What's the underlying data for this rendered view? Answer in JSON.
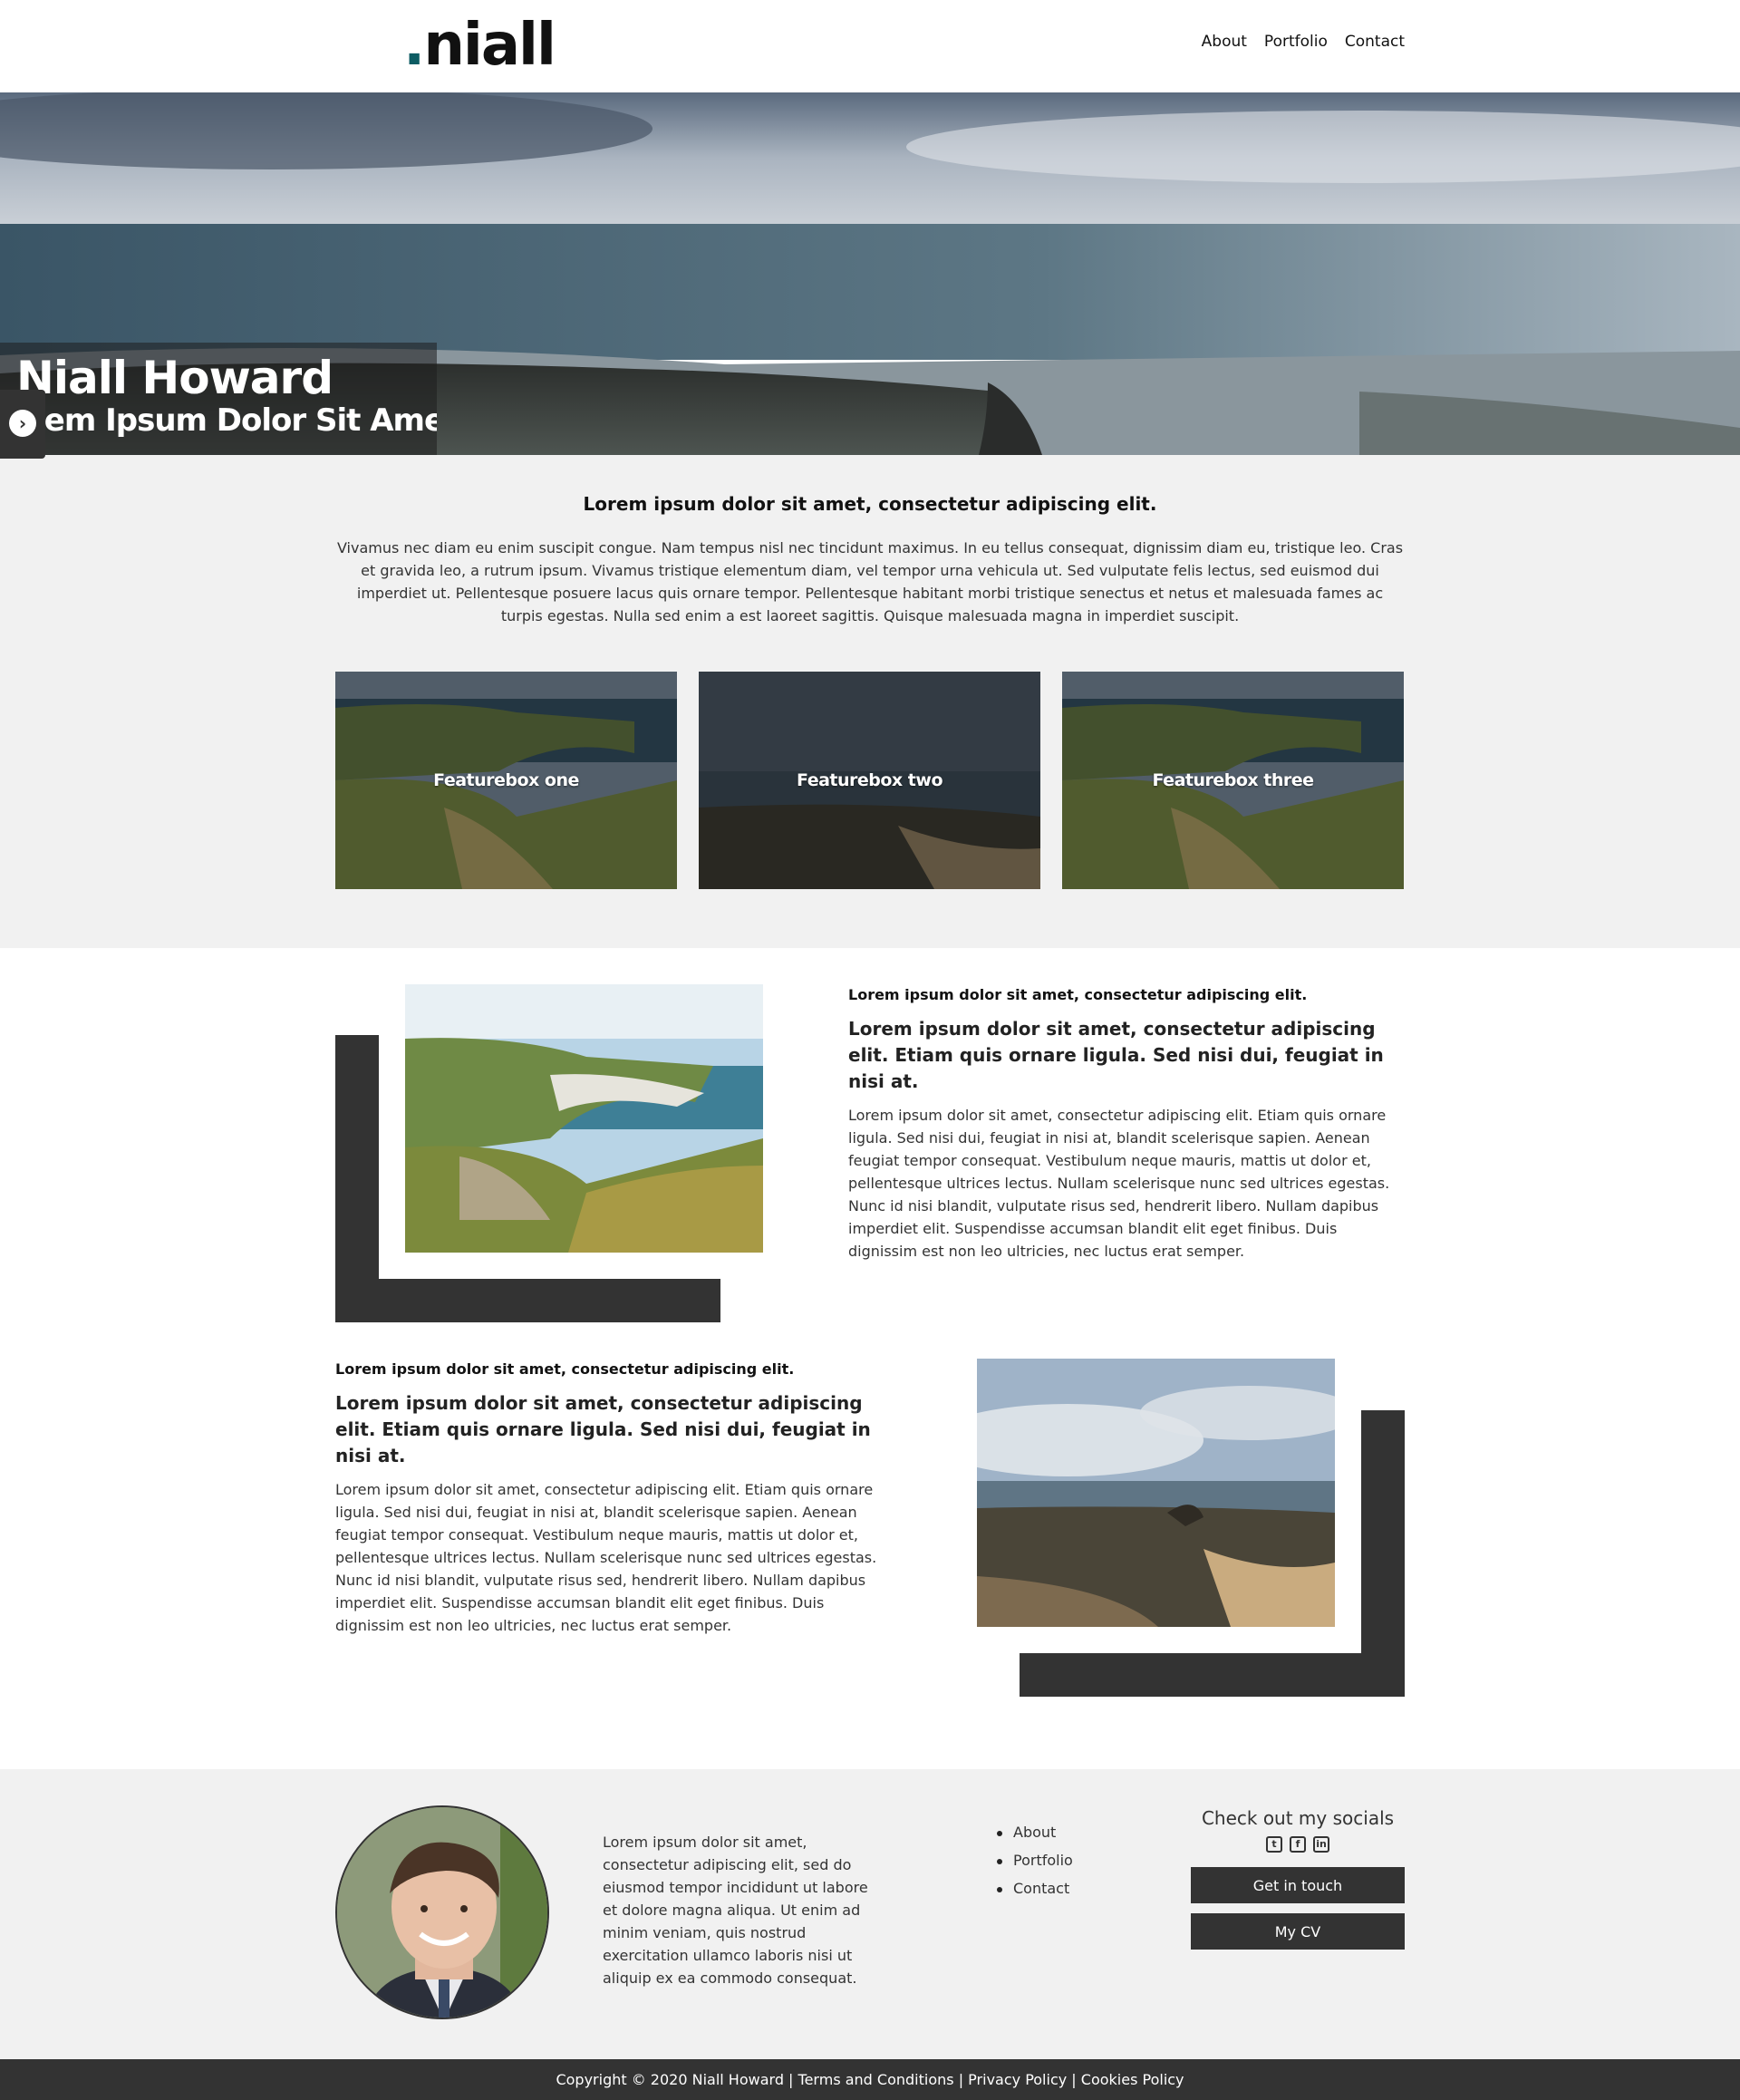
{
  "header": {
    "logo_dot": ".",
    "logo_text": "niall",
    "nav": [
      {
        "label": "About"
      },
      {
        "label": "Portfolio"
      },
      {
        "label": "Contact"
      }
    ]
  },
  "hero": {
    "name": "Niall Howard",
    "tagline": "Lorem Ipsum Dolor Sit Amet",
    "arrow_icon": "chevron-right-circle-icon"
  },
  "intro": {
    "title": "Lorem ipsum dolor sit amet, consectetur adipiscing elit.",
    "body": "Vivamus nec diam eu enim suscipit congue. Nam tempus nisl nec tincidunt maximus. In eu tellus consequat, dignissim diam eu, tristique leo. Cras et gravida leo, a rutrum ipsum. Vivamus tristique elementum diam, vel tempor urna vehicula ut. Sed vulputate felis lectus, sed euismod dui imperdiet ut. Pellentesque posuere lacus quis ornare tempor. Pellentesque habitant morbi tristique senectus et netus et malesuada fames ac turpis egestas. Nulla sed enim a est laoreet sagittis. Quisque malesuada magna in imperdiet suscipit.",
    "featureboxes": [
      {
        "label": "Featurebox one"
      },
      {
        "label": "Featurebox two"
      },
      {
        "label": "Featurebox three"
      }
    ]
  },
  "content": [
    {
      "kicker": "Lorem ipsum dolor sit amet, consectetur adipiscing elit.",
      "heading": "Lorem ipsum dolor sit amet, consectetur adipiscing elit. Etiam quis ornare ligula. Sed nisi dui, feugiat in nisi at.",
      "body": "Lorem ipsum dolor sit amet, consectetur adipiscing elit. Etiam quis ornare ligula. Sed nisi dui, feugiat in nisi at, blandit scelerisque sapien. Aenean feugiat tempor consequat. Vestibulum neque mauris, mattis ut dolor et, pellentesque ultrices lectus. Nullam scelerisque nunc sed ultrices egestas. Nunc id nisi blandit, vulputate risus sed, hendrerit libero. Nullam dapibus imperdiet elit. Suspendisse accumsan blandit elit eget finibus. Duis dignissim est non leo ultricies, nec luctus erat semper."
    },
    {
      "kicker": "Lorem ipsum dolor sit amet, consectetur adipiscing elit.",
      "heading": "Lorem ipsum dolor sit amet, consectetur adipiscing elit. Etiam quis ornare ligula. Sed nisi dui, feugiat in nisi at.",
      "body": "Lorem ipsum dolor sit amet, consectetur adipiscing elit. Etiam quis ornare ligula. Sed nisi dui, feugiat in nisi at, blandit scelerisque sapien. Aenean feugiat tempor consequat. Vestibulum neque mauris, mattis ut dolor et, pellentesque ultrices lectus. Nullam scelerisque nunc sed ultrices egestas. Nunc id nisi blandit, vulputate risus sed, hendrerit libero. Nullam dapibus imperdiet elit. Suspendisse accumsan blandit elit eget finibus. Duis dignissim est non leo ultricies, nec luctus erat semper."
    }
  ],
  "footer": {
    "about": "Lorem ipsum dolor sit amet, consectetur adipiscing elit, sed do eiusmod tempor incididunt ut labore et dolore magna aliqua. Ut enim ad minim veniam, quis nostrud exercitation ullamco laboris nisi ut aliquip ex ea commodo consequat.",
    "links": [
      {
        "label": "About"
      },
      {
        "label": "Portfolio"
      },
      {
        "label": "Contact"
      }
    ],
    "socials_title": "Check out my socials",
    "social_icons": [
      "twitter-icon",
      "facebook-icon",
      "linkedin-icon"
    ],
    "get_in_touch": "Get in touch",
    "my_cv": "My CV"
  },
  "copyright": "Copyright © 2020 Niall Howard | Terms and Conditions | Privacy Policy | Cookies Policy",
  "colors": {
    "brand_dot": "#0d5c63",
    "dark": "#333333",
    "section_bg": "#f1f1f1"
  }
}
